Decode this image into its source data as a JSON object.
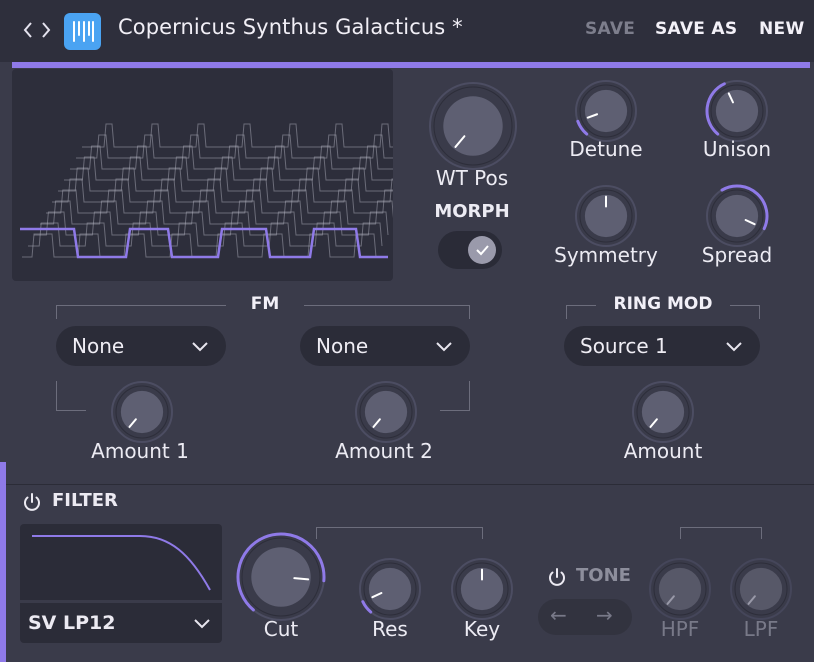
{
  "header": {
    "prev_label": "‹",
    "next_label": "›",
    "preset_name": "Copernicus Synthus Galacticus *",
    "save": "SAVE",
    "save_as": "SAVE AS",
    "new": "NEW"
  },
  "colors": {
    "accent": "#8f7ae8",
    "logo": "#4aa3f2",
    "panel": "#3a3b4a",
    "header": "#2e2f3c",
    "dark_field": "#2b2c38"
  },
  "oscillator": {
    "wt_pos_label": "WT Pos",
    "morph_label": "MORPH",
    "morph_enabled": true,
    "knobs": {
      "detune": {
        "label": "Detune"
      },
      "unison": {
        "label": "Unison"
      },
      "symmetry": {
        "label": "Symmetry"
      },
      "spread": {
        "label": "Spread"
      }
    }
  },
  "fm": {
    "title": "FM",
    "source_1": "None",
    "source_2": "None",
    "amount_1_label": "Amount 1",
    "amount_2_label": "Amount 2"
  },
  "ring_mod": {
    "title": "RING MOD",
    "source": "Source 1",
    "amount_label": "Amount"
  },
  "filter": {
    "title": "FILTER",
    "type": "SV LP12",
    "cut_label": "Cut",
    "res_label": "Res",
    "key_label": "Key"
  },
  "tone": {
    "title": "TONE",
    "left_arrow": "←",
    "right_arrow": "→",
    "hpf_label": "HPF",
    "lpf_label": "LPF"
  }
}
